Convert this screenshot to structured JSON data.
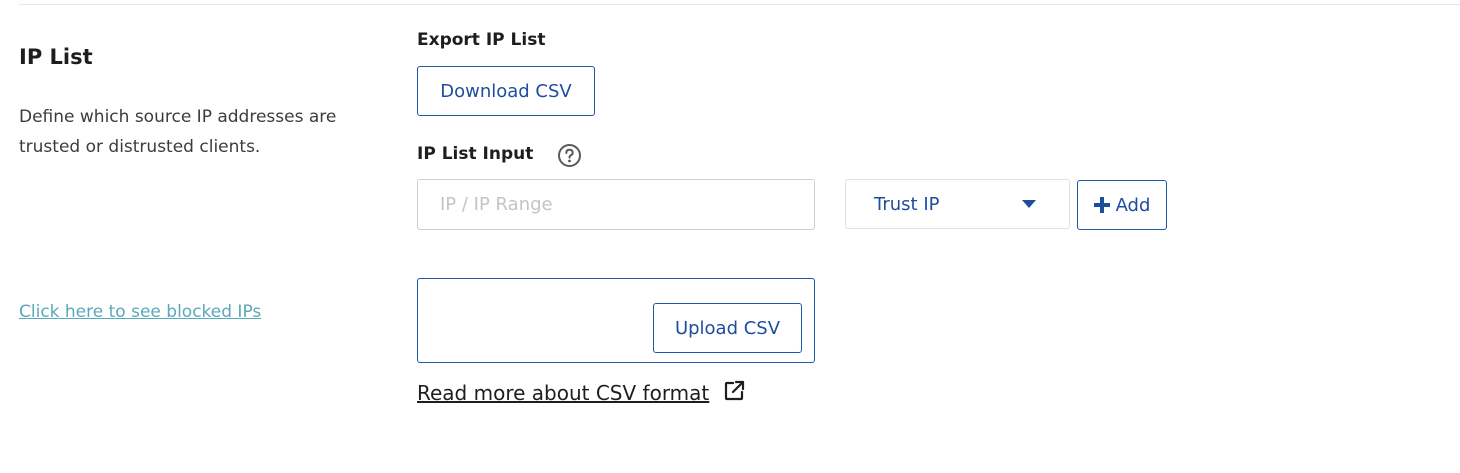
{
  "section": {
    "title": "IP List",
    "description": "Define which source IP addresses are trusted or distrusted clients.",
    "blocked_link": "Click here to see blocked IPs"
  },
  "export": {
    "label": "Export IP List",
    "download_label": "Download CSV"
  },
  "ip_input": {
    "label": "IP List Input",
    "help_icon": "question-circle-icon",
    "placeholder": "IP / IP Range",
    "value": "",
    "select_value": "Trust IP",
    "add_label": "Add",
    "add_icon": "plus-icon"
  },
  "upload": {
    "upload_label": "Upload CSV",
    "read_more": "Read more about CSV format",
    "external_icon": "external-link-icon"
  },
  "colors": {
    "accent": "#1f4d9e",
    "link": "#5aa9b8",
    "text": "#1e1e1e"
  }
}
